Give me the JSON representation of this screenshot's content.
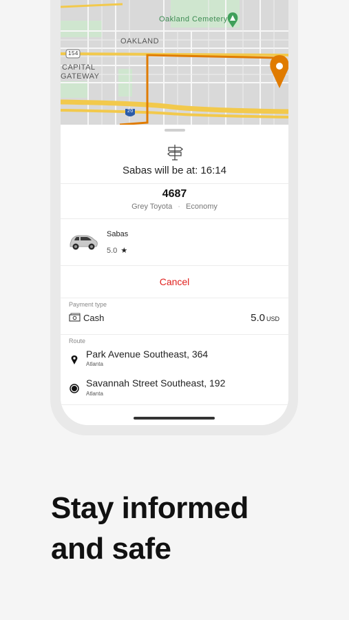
{
  "map": {
    "labels": [
      "Oakland Cemetery",
      "OAKLAND",
      "CAPITAL",
      "GATEWAY"
    ],
    "shields": [
      "154",
      "20"
    ],
    "route_color": "#e07b00",
    "pin_icon": "destination-pin-icon",
    "cemetery_icon": "tree-marker-icon"
  },
  "trip": {
    "eta_icon": "signpost-icon",
    "eta_text": "Sabas will be at: 16:14",
    "plate": "4687",
    "vehicle_color_model": "Grey Toyota",
    "separator": "·",
    "vehicle_class": "Economy"
  },
  "driver": {
    "name": "Sabas",
    "rating": "5.0",
    "star": "★",
    "car_icon": "car-icon"
  },
  "actions": {
    "cancel_label": "Cancel"
  },
  "payment": {
    "label": "Payment type",
    "icon": "cash-icon",
    "method": "Cash",
    "amount": "5.0",
    "currency": "USD"
  },
  "route": {
    "label": "Route",
    "stops": [
      {
        "icon": "pickup-pin-icon",
        "address": "Park Avenue Southeast, 364",
        "city": "Atlanta"
      },
      {
        "icon": "destination-dot-icon",
        "address": "Savannah Street Southeast, 192",
        "city": "Atlanta"
      }
    ]
  },
  "headline": {
    "line1": "Stay informed",
    "line2": "and safe"
  },
  "colors": {
    "accent_red": "#e0201d",
    "route_orange": "#e07b00",
    "background": "#f5f5f5"
  }
}
